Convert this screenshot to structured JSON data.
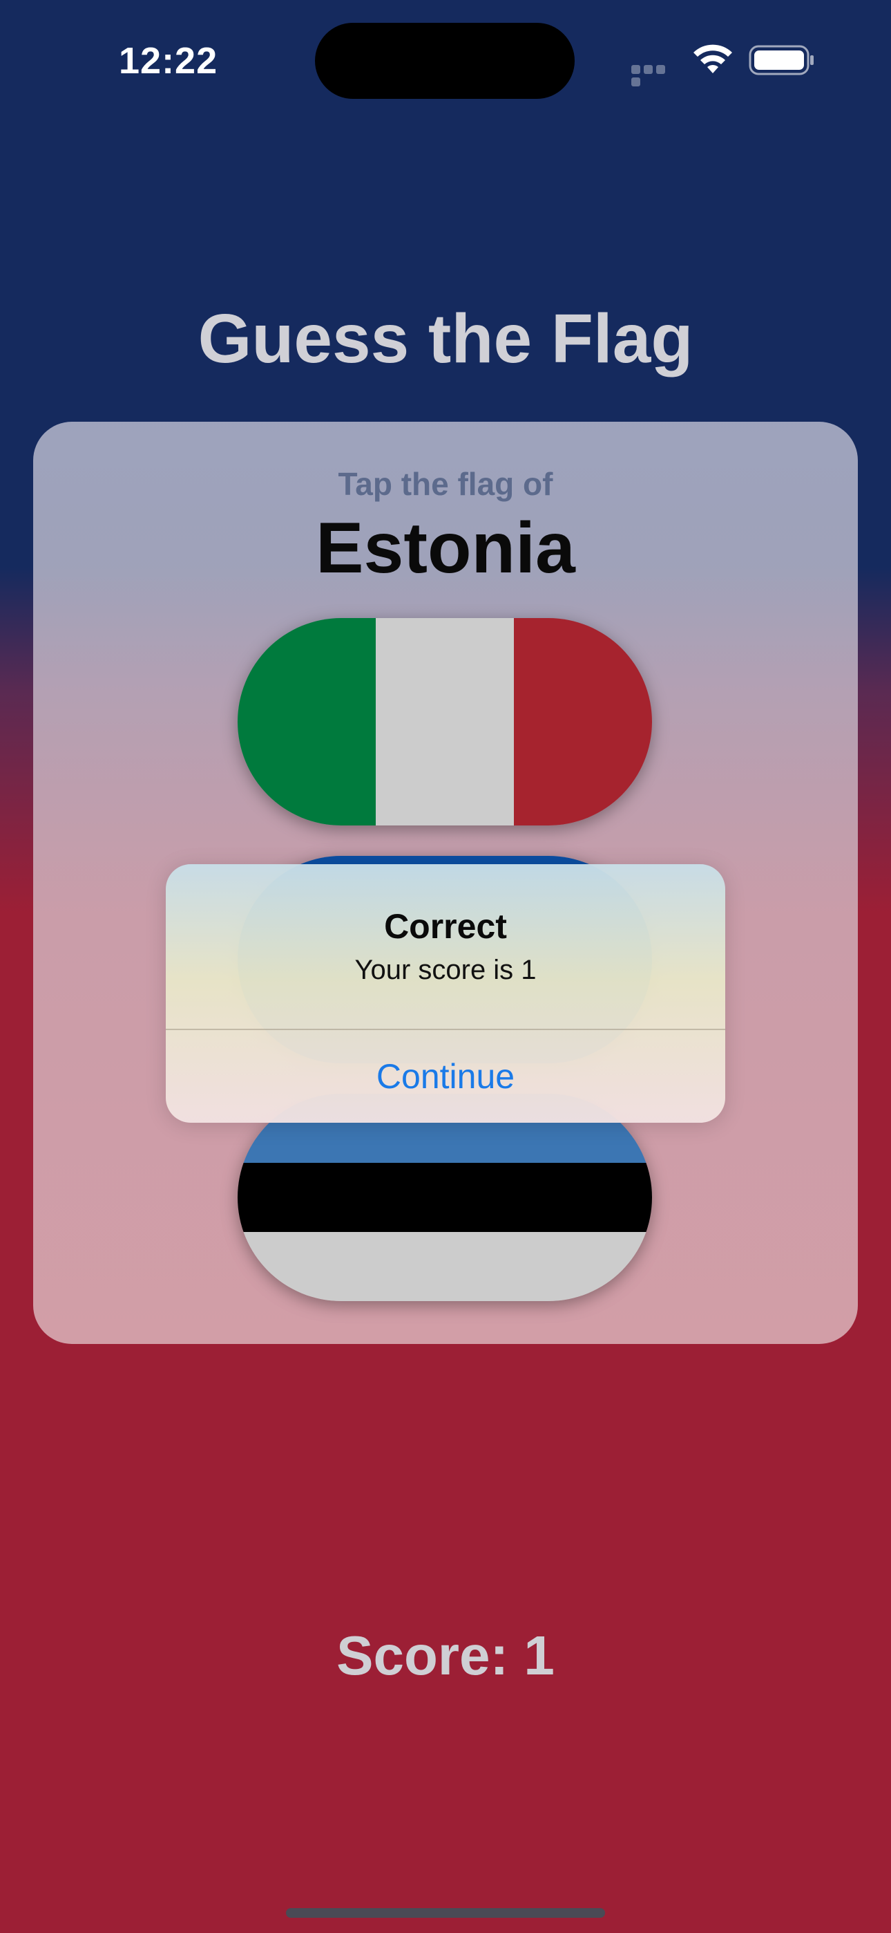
{
  "status_bar": {
    "time": "12:22",
    "icons": [
      "cellular-signal-icon",
      "wifi-icon",
      "battery-icon"
    ]
  },
  "app": {
    "title": "Guess the Flag",
    "background_colors": {
      "top": "#152a5e",
      "bottom": "#9c1f35"
    }
  },
  "card": {
    "prompt": "Tap the flag of",
    "country": "Estonia"
  },
  "flags": [
    {
      "country": "Italy",
      "orientation": "vertical",
      "stripes": [
        "#007a3d",
        "#cccccc",
        "#a6232e"
      ]
    },
    {
      "country": "hidden",
      "orientation": "horizontal",
      "stripes": [
        "#0b4ea2",
        "#0b4ea2",
        "#0b4ea2"
      ]
    },
    {
      "country": "Estonia",
      "orientation": "horizontal",
      "stripes": [
        "#3c76b3",
        "#000000",
        "#cccccc"
      ]
    }
  ],
  "alert": {
    "title": "Correct",
    "message": "Your score is 1",
    "button_label": "Continue",
    "button_color": "#1a7ae8"
  },
  "score": {
    "label": "Score: 1"
  }
}
